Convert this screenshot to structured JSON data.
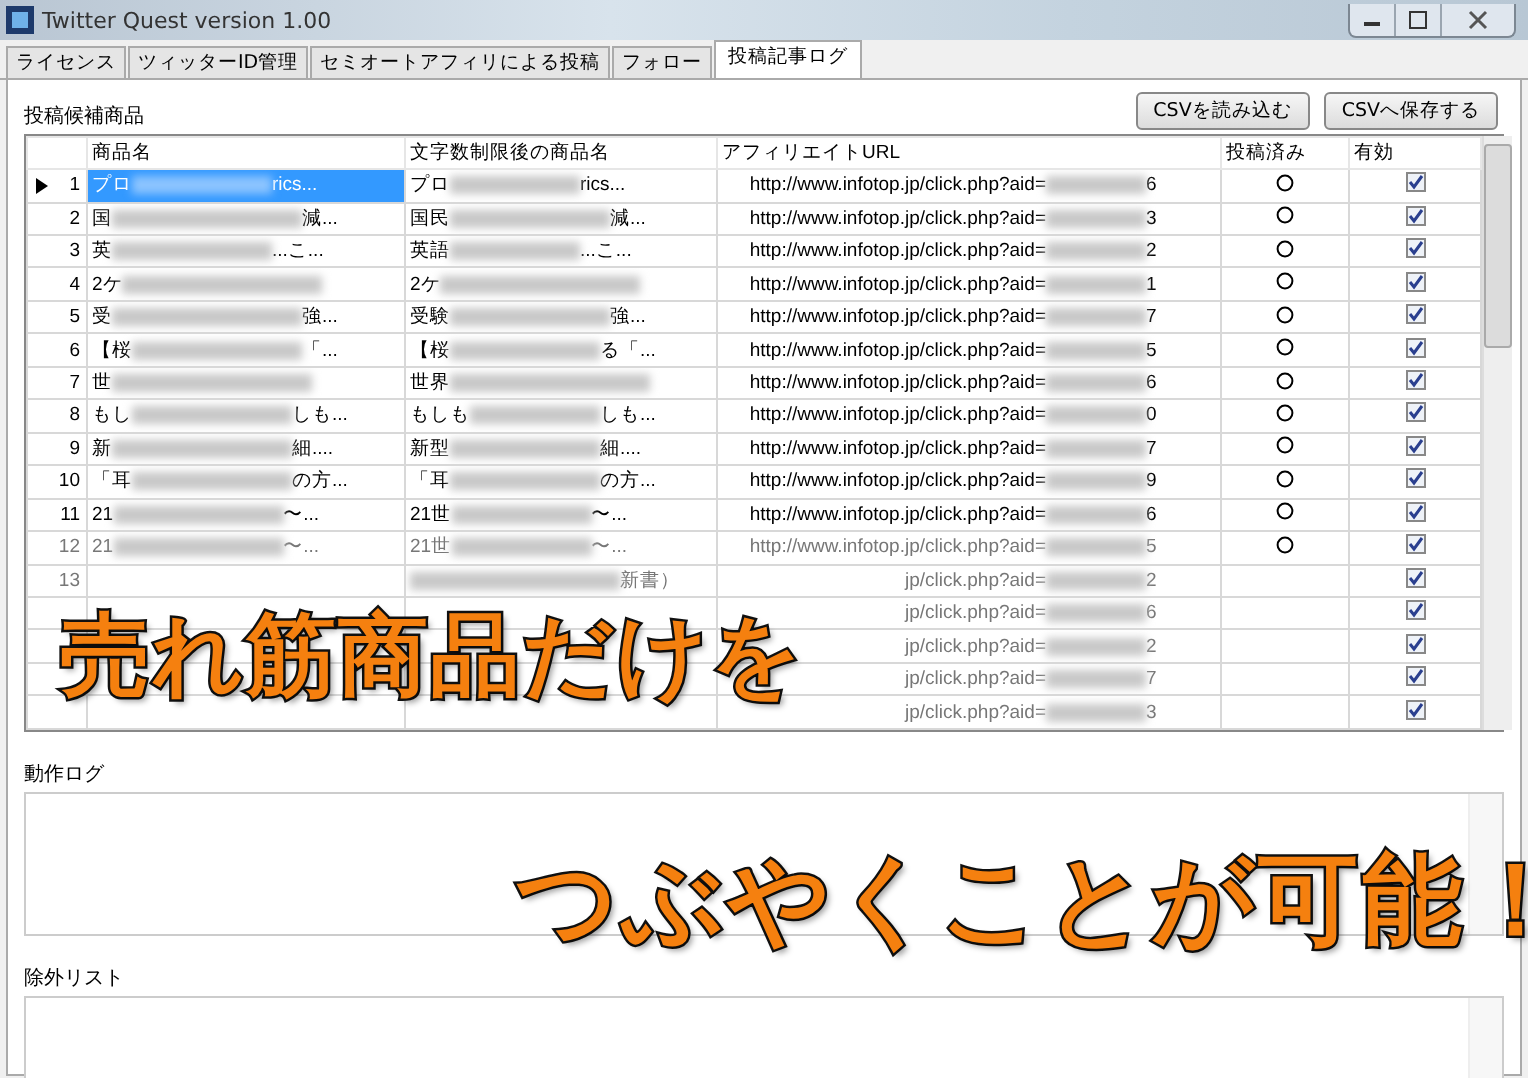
{
  "window": {
    "title": "Twitter Quest version 1.00"
  },
  "tabs": [
    {
      "label": "ライセンス",
      "selected": false
    },
    {
      "label": "ツィッターID管理",
      "selected": false
    },
    {
      "label": "セミオートアフィリによる投稿",
      "selected": false
    },
    {
      "label": "フォロー",
      "selected": false
    },
    {
      "label": "投稿記事ログ",
      "selected": true
    }
  ],
  "candidates": {
    "label": "投稿候補商品",
    "buttons": [
      "CSVを読み込む",
      "CSVへ保存する"
    ],
    "columns": [
      "商品名",
      "文字数制限後の商品名",
      "アフィリエイトURL",
      "投稿済み",
      "有効"
    ],
    "rows": [
      {
        "number": "1",
        "selected": true,
        "faded": false,
        "name_start": "プロ",
        "name_end": "rics...",
        "short_start": "プロ",
        "short_end": "rics...",
        "url_start": "http://www.infotop.jp/click.php?aid=",
        "url_end": "6",
        "posted": true,
        "valid": true
      },
      {
        "number": "2",
        "selected": false,
        "faded": false,
        "name_start": "国",
        "name_end": "減...",
        "short_start": "国民",
        "short_end": "減...",
        "url_start": "http://www.infotop.jp/click.php?aid=",
        "url_end": "3",
        "posted": true,
        "valid": true
      },
      {
        "number": "3",
        "selected": false,
        "faded": false,
        "name_start": "英",
        "name_end": "...こ...",
        "short_start": "英語",
        "short_end": "...こ...",
        "url_start": "http://www.infotop.jp/click.php?aid=",
        "url_end": "2",
        "posted": true,
        "valid": true
      },
      {
        "number": "4",
        "selected": false,
        "faded": false,
        "name_start": "2ケ",
        "short_start": "2ケ",
        "url_start": "http://www.infotop.jp/click.php?aid=",
        "url_end": "1",
        "posted": true,
        "valid": true
      },
      {
        "number": "5",
        "selected": false,
        "faded": false,
        "name_start": "受",
        "name_end": "強...",
        "short_start": "受験",
        "short_end": "強...",
        "url_start": "http://www.infotop.jp/click.php?aid=",
        "url_end": "7",
        "posted": true,
        "valid": true
      },
      {
        "number": "6",
        "selected": false,
        "faded": false,
        "name_start": "【桜",
        "name_end": "「...",
        "short_start": "【桜",
        "short_end": "る「...",
        "url_start": "http://www.infotop.jp/click.php?aid=",
        "url_end": "5",
        "posted": true,
        "valid": true
      },
      {
        "number": "7",
        "selected": false,
        "faded": false,
        "name_start": "世",
        "short_start": "世界",
        "url_start": "http://www.infotop.jp/click.php?aid=",
        "url_end": "6",
        "posted": true,
        "valid": true
      },
      {
        "number": "8",
        "selected": false,
        "faded": false,
        "name_start": "もし",
        "name_end": "しも...",
        "short_start": "もしも",
        "short_end": "しも...",
        "url_start": "http://www.infotop.jp/click.php?aid=",
        "url_end": "0",
        "posted": true,
        "valid": true
      },
      {
        "number": "9",
        "selected": false,
        "faded": false,
        "name_start": "新",
        "name_end": "細....",
        "short_start": "新型",
        "short_end": "細....",
        "url_start": "http://www.infotop.jp/click.php?aid=",
        "url_end": "7",
        "posted": true,
        "valid": true
      },
      {
        "number": "10",
        "selected": false,
        "faded": false,
        "name_start": "「耳",
        "name_end": "の方...",
        "short_start": "「耳",
        "short_end": "の方...",
        "url_start": "http://www.infotop.jp/click.php?aid=",
        "url_end": "9",
        "posted": true,
        "valid": true
      },
      {
        "number": "11",
        "selected": false,
        "faded": false,
        "name_start": "21",
        "name_end": "〜...",
        "short_start": "21世",
        "short_end": "〜...",
        "url_start": "http://www.infotop.jp/click.php?aid=",
        "url_end": "6",
        "posted": true,
        "valid": true
      },
      {
        "number": "12",
        "selected": false,
        "faded": true,
        "name_start": "21",
        "name_end": "〜...",
        "short_start": "21世",
        "short_end": "〜...",
        "url_start": "http://www.infotop.jp/click.php?aid=",
        "url_end": "5",
        "posted": true,
        "valid": true
      },
      {
        "number": "13",
        "selected": false,
        "faded": true,
        "short_end": "新書）",
        "url_start": "jp/click.php?aid=",
        "url_end": "2",
        "posted": false,
        "valid": true
      },
      {
        "selected": false,
        "faded": true,
        "url_start": "jp/click.php?aid=",
        "url_end": "6",
        "posted": false,
        "valid": true
      },
      {
        "selected": false,
        "faded": true,
        "url_start": "jp/click.php?aid=",
        "url_end": "2",
        "posted": false,
        "valid": true
      },
      {
        "selected": false,
        "faded": true,
        "url_start": "jp/click.php?aid=",
        "url_end": "7",
        "posted": false,
        "valid": true
      },
      {
        "selected": false,
        "faded": true,
        "url_start": "jp/click.php?aid=",
        "url_end": "3",
        "posted": false,
        "valid": true
      }
    ]
  },
  "action_log": {
    "label": "動作ログ"
  },
  "exclusion_list": {
    "label": "除外リスト"
  },
  "captions": [
    "売れ筋商品だけを",
    "つぶやくことが可能！"
  ]
}
